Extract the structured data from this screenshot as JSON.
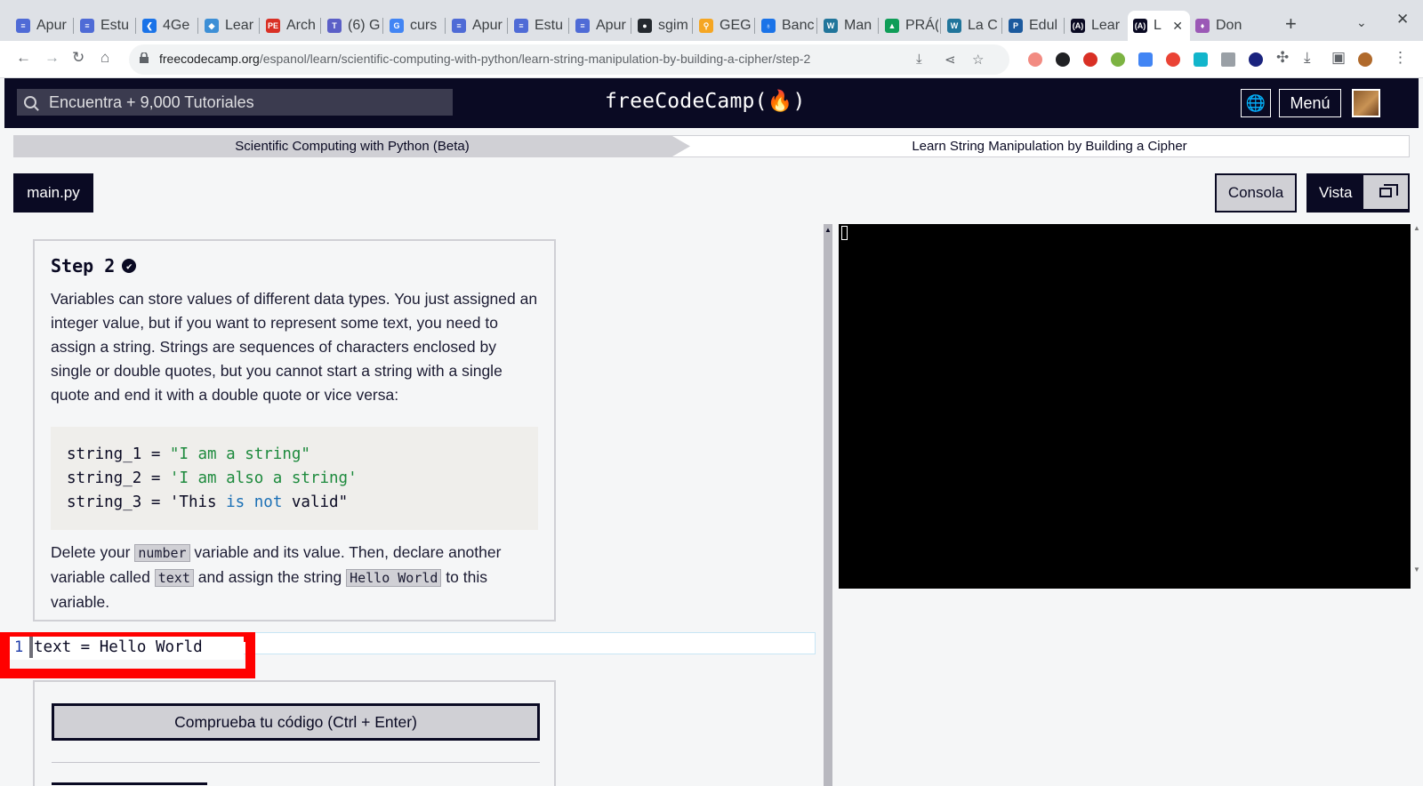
{
  "browser": {
    "tabs": [
      {
        "label": "Apur",
        "color": "#4f6bd6",
        "glyph": "≡"
      },
      {
        "label": "Estu",
        "color": "#4f6bd6",
        "glyph": "≡"
      },
      {
        "label": "4Ge",
        "color": "#1a73e8",
        "glyph": "❮"
      },
      {
        "label": "Lear",
        "color": "#3d8fd6",
        "glyph": "◆"
      },
      {
        "label": "Arch",
        "color": "#d93025",
        "glyph": "PE"
      },
      {
        "label": "(6) G",
        "color": "#5b5fc7",
        "glyph": "T"
      },
      {
        "label": "curs",
        "color": "#4285f4",
        "glyph": "G"
      },
      {
        "label": "Apur",
        "color": "#4f6bd6",
        "glyph": "≡"
      },
      {
        "label": "Estu",
        "color": "#4f6bd6",
        "glyph": "≡"
      },
      {
        "label": "Apur",
        "color": "#4f6bd6",
        "glyph": "≡"
      },
      {
        "label": "sgim",
        "color": "#24292f",
        "glyph": "●"
      },
      {
        "label": "GEG",
        "color": "#f5a623",
        "glyph": "⚲"
      },
      {
        "label": "Banc",
        "color": "#1a73e8",
        "glyph": "♁"
      },
      {
        "label": "Man",
        "color": "#21759b",
        "glyph": "W"
      },
      {
        "label": "PRÁ(",
        "color": "#0f9d58",
        "glyph": "▲"
      },
      {
        "label": "La C",
        "color": "#21759b",
        "glyph": "W"
      },
      {
        "label": "Edul",
        "color": "#1c5a9e",
        "glyph": "P"
      },
      {
        "label": "Lear",
        "color": "#0a0a23",
        "glyph": "(A)"
      },
      {
        "label": "L",
        "color": "#0a0a23",
        "glyph": "(A)"
      },
      {
        "label": "Don",
        "color": "#9b59b6",
        "glyph": "♦"
      }
    ],
    "active_tab_index": 18,
    "url_host": "freecodecamp.org",
    "url_path": "/espanol/learn/scientific-computing-with-python/learn-string-manipulation-by-building-a-cipher/step-2"
  },
  "nav": {
    "search_placeholder": "Encuentra + 9,000 Tutoriales",
    "logo": "freeCodeCamp(🔥)",
    "menu_label": "Menú",
    "globe_glyph": "🌐"
  },
  "breadcrumb": {
    "superblock": "Scientific Computing with Python (Beta)",
    "block": "Learn String Manipulation by Building a Cipher"
  },
  "toolbar": {
    "file_tab": "main.py",
    "console_label": "Consola",
    "preview_label": "Vista"
  },
  "step": {
    "title": "Step 2",
    "check_glyph": "✔",
    "description": "Variables can store values of different data types. You just assigned an integer value, but if you want to represent some text, you need to assign a string. Strings are sequences of characters enclosed by single or double quotes, but you cannot start a string with a single quote and end it with a double quote or vice versa:",
    "code": {
      "l1_var": "string_1 = ",
      "l1_str": "\"I am a string\"",
      "l2_var": "string_2 = ",
      "l2_str": "'I am also a string'",
      "l3_a": "string_3 = 'This ",
      "l3_kw1": "is",
      "l3_sp": " ",
      "l3_kw2": "not",
      "l3_b": " valid\""
    },
    "instruction": {
      "p1": "Delete your ",
      "c1": "number",
      "p2": " variable and its value. Then, declare another variable called ",
      "c2": "text",
      "p3": " and assign the string ",
      "c3": "Hello World",
      "p4": " to this variable."
    }
  },
  "editor": {
    "line_number": "1",
    "line_text": "text = Hello World"
  },
  "check_button": "Comprueba tu código (Ctrl + Enter)",
  "colors": {
    "fcc_dark": "#0a0a23",
    "highlight_red": "#ff0000",
    "string_green": "#1d8a3d",
    "keyword_blue": "#1a6fb5"
  }
}
